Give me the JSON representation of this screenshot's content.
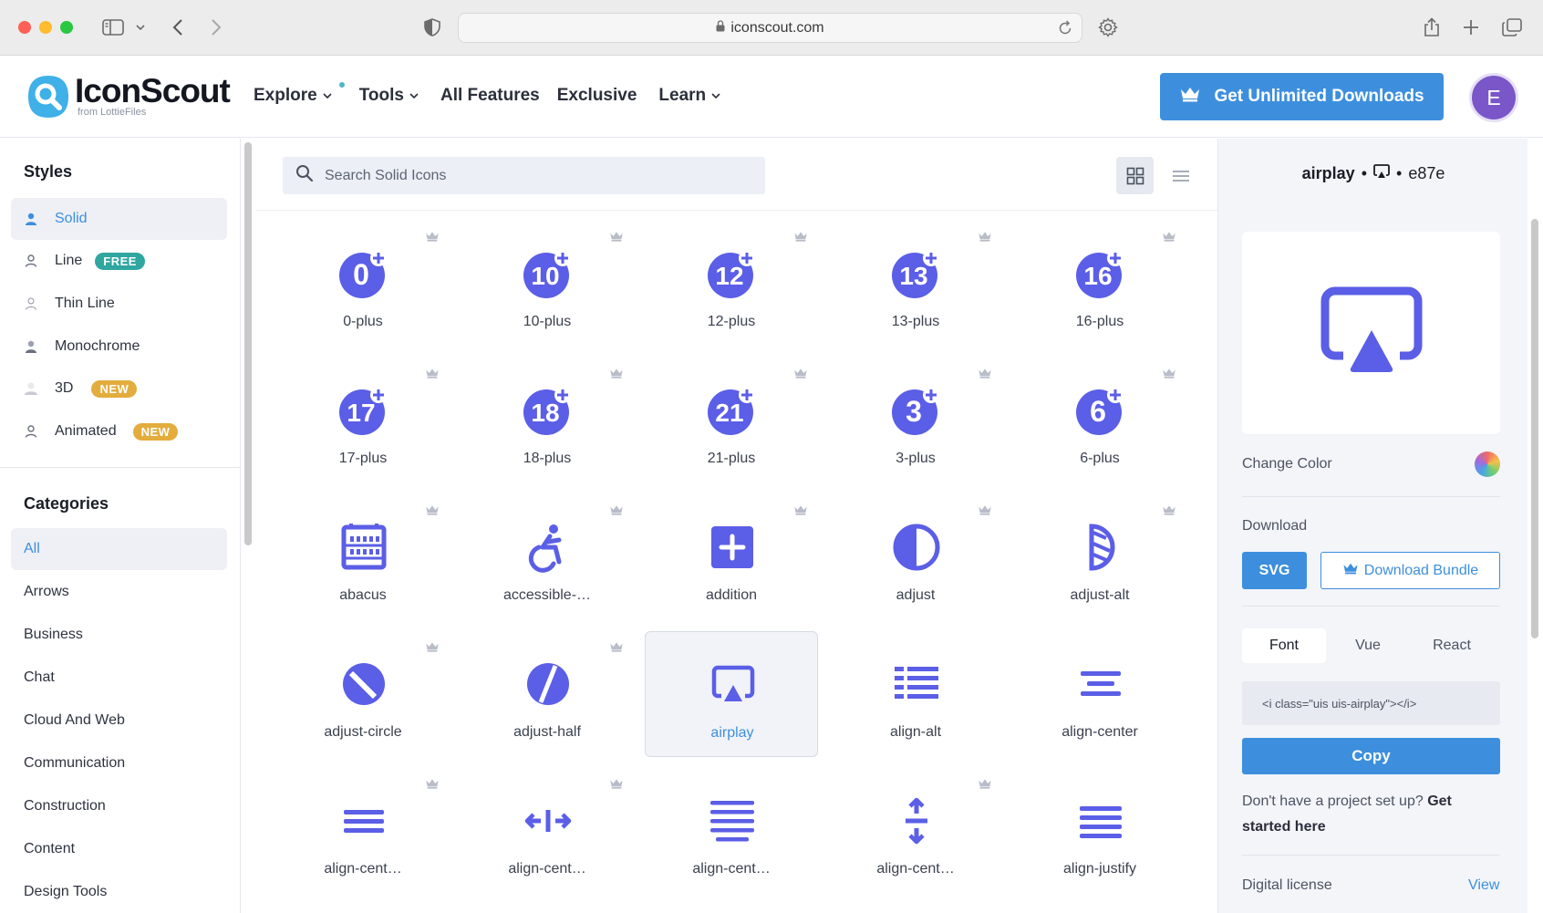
{
  "browser": {
    "url": "iconscout.com"
  },
  "header": {
    "logo_name": "IconScout",
    "logo_sub": "from LottieFiles",
    "nav": [
      {
        "label": "Explore",
        "has_menu": true,
        "has_dot": true
      },
      {
        "label": "Tools",
        "has_menu": true
      },
      {
        "label": "All Features",
        "has_menu": false
      },
      {
        "label": "Exclusive",
        "has_menu": false
      },
      {
        "label": "Learn",
        "has_menu": true
      }
    ],
    "cta_label": "Get Unlimited Downloads",
    "avatar_initial": "E"
  },
  "sidebar": {
    "styles_heading": "Styles",
    "styles": [
      {
        "label": "Solid",
        "active": true,
        "badge": ""
      },
      {
        "label": "Line",
        "active": false,
        "badge": "FREE"
      },
      {
        "label": "Thin Line",
        "active": false,
        "badge": ""
      },
      {
        "label": "Monochrome",
        "active": false,
        "badge": ""
      },
      {
        "label": "3D",
        "active": false,
        "badge": "NEW"
      },
      {
        "label": "Animated",
        "active": false,
        "badge": "NEW"
      }
    ],
    "categories_heading": "Categories",
    "categories": [
      "All",
      "Arrows",
      "Business",
      "Chat",
      "Cloud And Web",
      "Communication",
      "Construction",
      "Content",
      "Design Tools"
    ]
  },
  "main": {
    "search_placeholder": "Search Solid Icons",
    "icons": [
      {
        "label": "0-plus",
        "icon": "0-plus-icon",
        "premium": true
      },
      {
        "label": "10-plus",
        "icon": "10-plus-icon",
        "premium": true
      },
      {
        "label": "12-plus",
        "icon": "12-plus-icon",
        "premium": true
      },
      {
        "label": "13-plus",
        "icon": "13-plus-icon",
        "premium": true
      },
      {
        "label": "16-plus",
        "icon": "16-plus-icon",
        "premium": true
      },
      {
        "label": "17-plus",
        "icon": "17-plus-icon",
        "premium": true
      },
      {
        "label": "18-plus",
        "icon": "18-plus-icon",
        "premium": true
      },
      {
        "label": "21-plus",
        "icon": "21-plus-icon",
        "premium": true
      },
      {
        "label": "3-plus",
        "icon": "3-plus-icon",
        "premium": true
      },
      {
        "label": "6-plus",
        "icon": "6-plus-icon",
        "premium": true
      },
      {
        "label": "abacus",
        "icon": "abacus-icon",
        "premium": true
      },
      {
        "label": "accessible-…",
        "icon": "accessible-icon",
        "premium": true
      },
      {
        "label": "addition",
        "icon": "addition-icon",
        "premium": true
      },
      {
        "label": "adjust",
        "icon": "adjust-icon",
        "premium": true
      },
      {
        "label": "adjust-alt",
        "icon": "adjust-alt-icon",
        "premium": true
      },
      {
        "label": "adjust-circle",
        "icon": "adjust-circle-icon",
        "premium": true
      },
      {
        "label": "adjust-half",
        "icon": "adjust-half-icon",
        "premium": true
      },
      {
        "label": "airplay",
        "icon": "airplay-icon",
        "premium": false,
        "selected": true
      },
      {
        "label": "align-alt",
        "icon": "align-alt-icon",
        "premium": false
      },
      {
        "label": "align-center",
        "icon": "align-center-icon",
        "premium": false
      },
      {
        "label": "align-cent…",
        "icon": "align-center-alt-icon",
        "premium": true
      },
      {
        "label": "align-cent…",
        "icon": "align-center-h-icon",
        "premium": true
      },
      {
        "label": "align-cent…",
        "icon": "align-center-justify-icon",
        "premium": false
      },
      {
        "label": "align-cent…",
        "icon": "align-center-v-icon",
        "premium": true
      },
      {
        "label": "align-justify",
        "icon": "align-justify-icon",
        "premium": false
      }
    ]
  },
  "detail": {
    "name": "airplay",
    "code": "e87e",
    "change_color_label": "Change Color",
    "download_label": "Download",
    "svg_button": "SVG",
    "bundle_button": "Download Bundle",
    "tabs": [
      "Font",
      "Vue",
      "React"
    ],
    "active_tab": "Font",
    "snippet": "<i class=\"uis uis-airplay\"></i>",
    "copy_button": "Copy",
    "help_text": "Don't have a project set up?",
    "help_link": "Get started here",
    "license_label": "Digital license",
    "license_link": "View"
  },
  "colors": {
    "icon": "#5b5ee6",
    "accent": "#3d8fde",
    "free_badge": "#2fa6a0",
    "new_badge": "#e3ac3c",
    "avatar": "#7a56c8"
  }
}
